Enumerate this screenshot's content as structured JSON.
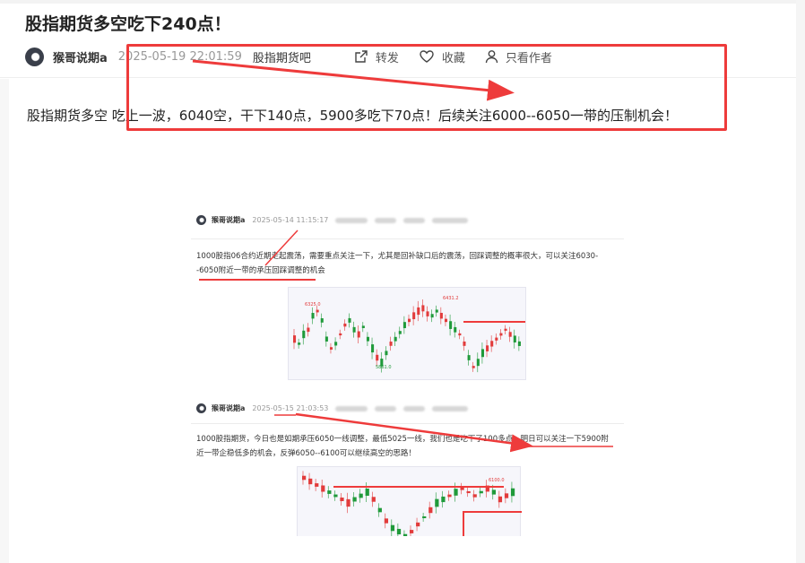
{
  "post": {
    "title": "股指期货多空吃下240点！",
    "author": "猴哥说期a",
    "timestamp": "2025-05-19 22:01:59",
    "forum": "股指期货吧",
    "actions": {
      "share": "转发",
      "favorite": "收藏",
      "author_only": "只看作者"
    },
    "body": "股指期货多空 吃上一波，6040空，干下140点，5900多吃下70点！后续关注6000--6050一带的压制机会！"
  },
  "annotation_color": "#ee3b3b",
  "embedded": [
    {
      "author": "猴哥说期a",
      "timestamp": "2025-05-14 11:15:17",
      "text": "1000股指06合约近期走起震荡，需要重点关注一下，尤其是回补缺口后的震荡，回踩调整的概率很大，可以关注6030--6050附近一带的承压回踩调整的机会",
      "chart_labels": {
        "high": "6431.2",
        "left_high": "6325.0",
        "low": "5861.0"
      }
    },
    {
      "author": "猴哥说期a",
      "timestamp": "2025-05-15 21:03:53",
      "text": "1000股指期货，今日也是如期承压6050一线调整，最低5025一线，我们也是吃下了100多点，明日可以关注一下5900附近一带企稳低多的机会，反弹6050--6100可以继续高空的思路！",
      "chart_labels": {
        "high": "6100.0"
      }
    }
  ]
}
